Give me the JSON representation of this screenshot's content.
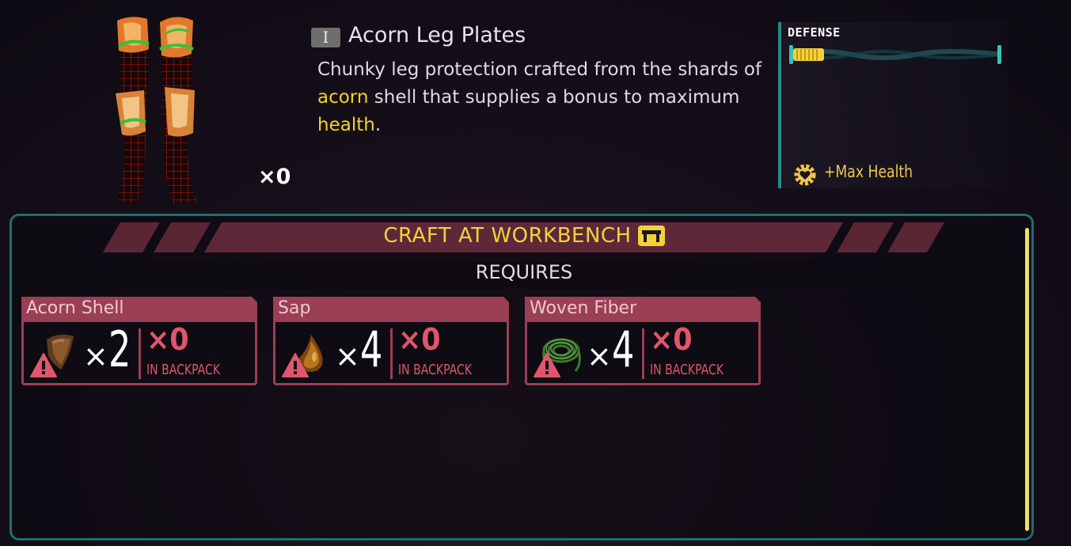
{
  "item": {
    "name": "Acorn Leg Plates",
    "tier": "I",
    "count": "×0",
    "description_parts": [
      "Chunky leg protection crafted from the shards of ",
      "acorn",
      " shell that supplies a bonus to maximum ",
      "health",
      "."
    ],
    "icon": "acorn-leg-plates-icon"
  },
  "stats": {
    "defense_label": "DEFENSE",
    "defense_fill": 0.15,
    "perk": "+Max Health",
    "perk_icon": "heart-gear-icon"
  },
  "craft": {
    "title": "CRAFT AT WORKBENCH",
    "workbench_icon": "workbench-icon",
    "requires_label": "REQUIRES",
    "requirements": [
      {
        "name": "Acorn Shell",
        "icon": "acorn-shell-icon",
        "x_symbol": "×",
        "required": "2",
        "have": "×0",
        "have_label": "IN BACKPACK",
        "warning": true
      },
      {
        "name": "Sap",
        "icon": "sap-drop-icon",
        "x_symbol": "×",
        "required": "4",
        "have": "×0",
        "have_label": "IN BACKPACK",
        "warning": true
      },
      {
        "name": "Woven Fiber",
        "icon": "woven-fiber-icon",
        "x_symbol": "×",
        "required": "4",
        "have": "×0",
        "have_label": "IN BACKPACK",
        "warning": true
      }
    ]
  },
  "colors": {
    "accent_yellow": "#f2d32a",
    "teal_border": "#1f6f6a",
    "missing_red": "#e0566c",
    "card_header": "#9a3f54",
    "perk_gold": "#f0c64b"
  }
}
